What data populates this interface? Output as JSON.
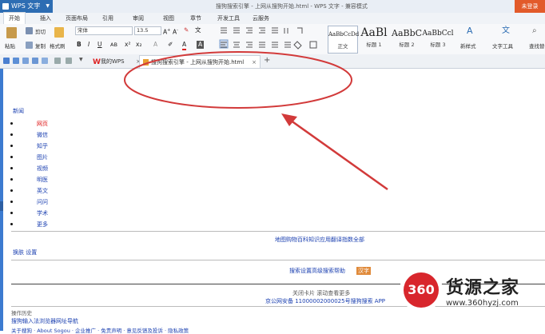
{
  "app": {
    "name": "WPS 文字",
    "window_title": "搜狗搜索引擎 - 上网从搜狗开始.html - WPS 文字 - 兼容模式",
    "login_label": "未登录"
  },
  "menus": [
    "开始",
    "插入",
    "页面布局",
    "引用",
    "审阅",
    "视图",
    "章节",
    "开发工具",
    "云服务"
  ],
  "ribbon": {
    "paste": "粘贴",
    "cut": "剪切",
    "copy": "复制",
    "format_painter": "格式刷",
    "font_name": "宋体",
    "font_size": "13.5",
    "styles": [
      {
        "preview": "AaBbCcDd",
        "label": "正文"
      },
      {
        "preview": "AaBl",
        "label": "标题 1"
      },
      {
        "preview": "AaBbC",
        "label": "标题 2"
      },
      {
        "preview": "AaBbCcl",
        "label": "标题 3"
      }
    ],
    "new_style": "新样式",
    "text_tools": "文字工具",
    "find_replace": "查找替"
  },
  "tabs": {
    "my_wps": "我的WPS",
    "doc": "搜狗搜索引擎 - 上网从搜狗开始.html",
    "add": "+"
  },
  "doc": {
    "news_link": "新闻",
    "nav_items": [
      {
        "text": "网页",
        "active": true
      },
      {
        "text": "微信",
        "active": false
      },
      {
        "text": "知乎",
        "active": false
      },
      {
        "text": "图片",
        "active": false
      },
      {
        "text": "视频",
        "active": false
      },
      {
        "text": "明医",
        "active": false
      },
      {
        "text": "英文",
        "active": false
      },
      {
        "text": "问问",
        "active": false
      },
      {
        "text": "学术",
        "active": false
      },
      {
        "text": "更多",
        "active": false
      }
    ],
    "link_row": "地图购物百科知识应用翻译指数全部",
    "skin_settings": "换肤 设置",
    "search_row": "搜索设置高级搜索帮助",
    "search_badge": "汉字",
    "close_card": "关闭卡片 滚动查看更多",
    "icp": "京公网安备 11000002000025号搜狗搜索 APP",
    "history": "操作历史",
    "bottom_link": "搜狗输入法浏览器网址导航",
    "footer": "关于搜狗 · About Sogou · 企业推广 · 免责声明 · 意见反馈及投诉 · 隐私政策"
  },
  "watermark": {
    "number": "360",
    "name": "货源之家",
    "url": "www.360hyzj.com"
  },
  "colors": {
    "app_blue": "#2d6db3",
    "annotation_red": "#d23a3a",
    "link_blue": "#1a3fb0"
  }
}
